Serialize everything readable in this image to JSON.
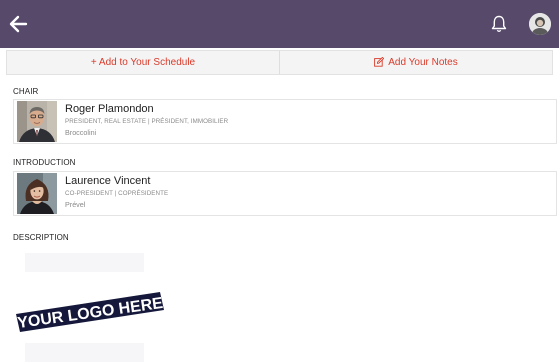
{
  "header": {
    "back_icon": "back-arrow-icon",
    "notification_icon": "bell-icon",
    "avatar_icon": "user-avatar-icon",
    "background_color": "#56496a"
  },
  "actions": {
    "add_schedule_label": "+ Add to Your Schedule",
    "add_notes_label": "Add Your Notes",
    "add_notes_icon": "edit-note-icon",
    "accent_color": "#d93b2b"
  },
  "chair": {
    "label": "CHAIR",
    "name": "Roger Plamondon",
    "title": "PRESIDENT, REAL ESTATE | PRÉSIDENT, IMMOBILIER",
    "organization": "Broccolini"
  },
  "introduction": {
    "label": "INTRODUCTION",
    "name": "Laurence Vincent",
    "title": "CO-PRESIDENT | COPRÉSIDENTE",
    "organization": "Prével"
  },
  "description": {
    "label": "DESCRIPTION",
    "logo_text": "YOUR LOGO HERE"
  }
}
